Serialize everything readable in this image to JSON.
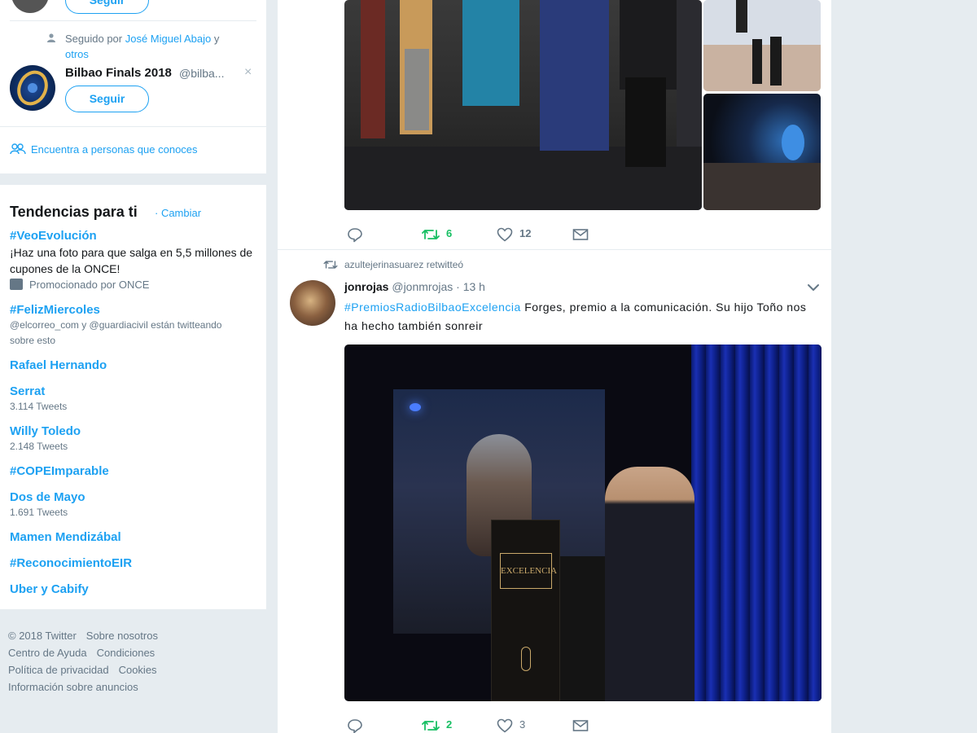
{
  "who_to_follow": {
    "follow_label": "Seguir",
    "followed_by_prefix": "Seguido por ",
    "followed_by_name": "José Miguel Abajo",
    "followed_by_and": " y",
    "followed_by_others": "otros",
    "suggestion_name": "Bilbao Finals 2018",
    "suggestion_handle": "@bilba...",
    "dismiss": "×",
    "find_people": "Encuentra a personas que conoces"
  },
  "trends": {
    "title": "Tendencias para ti",
    "change": "· Cambiar",
    "items": [
      {
        "name": "#VeoEvolución",
        "desc": "¡Haz una foto para que salga en 5,5 millones de cupones de la ONCE!",
        "meta": "Promocionado por ONCE"
      },
      {
        "name": "#FelizMiercoles",
        "meta": "@elcorreo_com y @guardiacivil están twitteando sobre esto"
      },
      {
        "name": "Rafael Hernando"
      },
      {
        "name": "Serrat",
        "meta": "3.114 Tweets"
      },
      {
        "name": "Willy Toledo",
        "meta": "2.148 Tweets"
      },
      {
        "name": "#COPEImparable"
      },
      {
        "name": "Dos de Mayo",
        "meta": "1.691 Tweets"
      },
      {
        "name": "Mamen Mendizábal"
      },
      {
        "name": "#ReconocimientoEIR"
      },
      {
        "name": "Uber y Cabify"
      }
    ]
  },
  "footer": {
    "links": [
      "© 2018 Twitter",
      "Sobre nosotros",
      "Centro de Ayuda",
      "Condiciones",
      "Política de privacidad",
      "Cookies",
      "Información sobre anuncios"
    ]
  },
  "tweet1": {
    "retweets": "6",
    "likes": "12"
  },
  "tweet2": {
    "retweeted_by": "azultejerinasuarez retwitteó",
    "name": "jonrojas",
    "handle": "@jonmrojas",
    "time": "· 13 h",
    "hashtag": "#PremiosRadioBilbaoExcelencia",
    "text": " Forges, premio a la comunicación. Su hijo Toño nos ha hecho también sonreir",
    "podium_sign": "EXCELENCIA",
    "retweets": "2",
    "likes": "3"
  },
  "colors": {
    "accent": "#1da1f2",
    "retweet": "#17bf63",
    "muted": "#657786",
    "background": "#e6ecf0"
  }
}
